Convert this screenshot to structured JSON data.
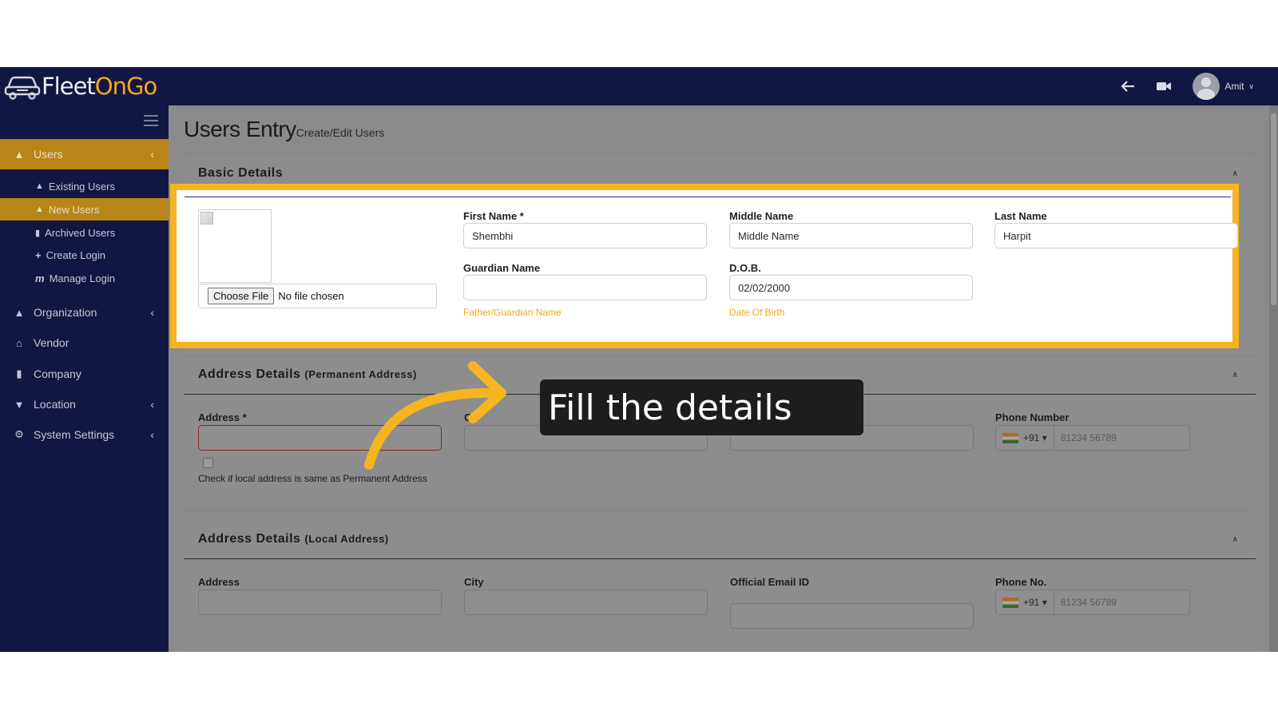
{
  "app": {
    "logo_dark": "Fleet",
    "logo_accent_on": "On",
    "logo_accent_go": "Go",
    "user_name": "Amit",
    "brand_color": "#121642",
    "accent_color": "#f5a623"
  },
  "sidebar": {
    "items": [
      {
        "label": "Users",
        "icon": "user-icon",
        "active": true
      },
      {
        "label": "Organization",
        "icon": "user-icon"
      },
      {
        "label": "Vendor",
        "icon": "home-icon"
      },
      {
        "label": "Company",
        "icon": "building-icon"
      },
      {
        "label": "Location",
        "icon": "map-pin-icon"
      },
      {
        "label": "System Settings",
        "icon": "gear-icon"
      }
    ],
    "users_sub": [
      {
        "label": "Existing Users",
        "icon": "user-icon"
      },
      {
        "label": "New Users",
        "icon": "user-icon",
        "active": true
      },
      {
        "label": "Archived Users",
        "icon": "trash-icon"
      },
      {
        "label": "Create Login",
        "icon": "plus-icon"
      },
      {
        "label": "Manage Login",
        "icon": "m-icon"
      }
    ]
  },
  "page": {
    "title": "Users Entry",
    "subtitle": "Create/Edit Users"
  },
  "basic": {
    "heading": "Basic Details",
    "choose_file": "Choose File",
    "no_file": "No file chosen",
    "first_name_label": "First Name *",
    "first_name_value": "Shembhi",
    "middle_name_label": "Middle Name",
    "middle_name_value": "Middle Name",
    "last_name_label": "Last Name",
    "last_name_value": "Harpit",
    "guardian_label": "Guardian Name",
    "guardian_value": "",
    "guardian_help": "Father/Guardian Name",
    "dob_label": "D.O.B.",
    "dob_value": "02/02/2000",
    "dob_help": "Date Of Birth"
  },
  "permanent": {
    "heading": "Address Details",
    "heading_sub": "(Permanent Address)",
    "address_label": "Address *",
    "city_label_partial": "Ci",
    "phone_label": "Phone Number",
    "country_code": "+91",
    "phone_placeholder": "81234 56789",
    "same_address_text": "Check if local address is same as Permanent Address"
  },
  "local": {
    "heading": "Address Details",
    "heading_sub": "(Local Address)",
    "address_label": "Address",
    "city_label": "City",
    "email_label": "Official Email ID",
    "phone_label": "Phone No.",
    "country_code": "+91",
    "phone_placeholder": "81234 56789"
  },
  "callout": {
    "text": "Fill the details"
  }
}
